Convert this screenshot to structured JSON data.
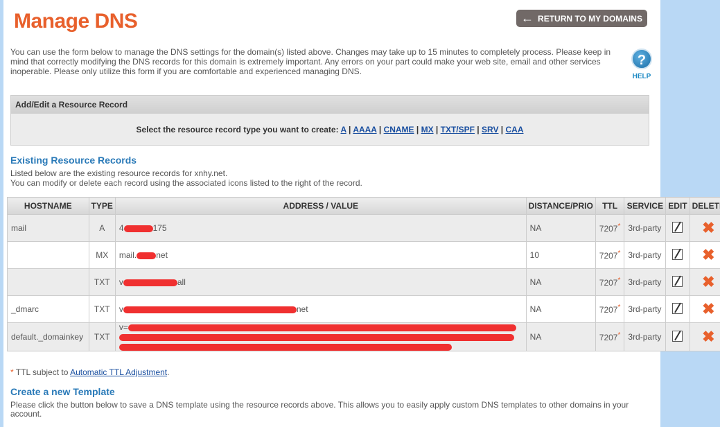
{
  "header": {
    "title": "Manage DNS",
    "return_label": "RETURN TO MY DOMAINS",
    "help_label": "HELP"
  },
  "intro": "You can use the form below to manage the DNS settings for the domain(s) listed above. Changes may take up to 15 minutes to completely process. Please keep in mind that correctly modifying the DNS records for this domain is extremely important. Any errors on your part could make your web site, email and other services inoperable. Please only utilize this form if you are comfortable and experienced managing DNS.",
  "add_record": {
    "title": "Add/Edit a Resource Record",
    "prompt": "Select the resource record type you want to create:",
    "types": [
      "A",
      "AAAA",
      "CNAME",
      "MX",
      "TXT/SPF",
      "SRV",
      "CAA"
    ]
  },
  "existing": {
    "title": "Existing Resource Records",
    "line1": "Listed below are the existing resource records for xnhy.net.",
    "line2": "You can modify or delete each record using the associated icons listed to the right of the record.",
    "columns": [
      "HOSTNAME",
      "TYPE",
      "ADDRESS / VALUE",
      "DISTANCE/PRIO",
      "TTL",
      "SERVICE",
      "EDIT",
      "DELETE"
    ],
    "rows": [
      {
        "host": "mail",
        "type": "A",
        "pre": "4",
        "post": "175",
        "prio": "NA",
        "ttl": "7207",
        "service": "3rd-party"
      },
      {
        "host": "",
        "type": "MX",
        "pre": "mail.",
        "post": "net",
        "prio": "10",
        "ttl": "7207",
        "service": "3rd-party"
      },
      {
        "host": "",
        "type": "TXT",
        "pre": "v",
        "post": "all",
        "prio": "NA",
        "ttl": "7207",
        "service": "3rd-party"
      },
      {
        "host": "_dmarc",
        "type": "TXT",
        "pre": "v",
        "post": "net",
        "prio": "NA",
        "ttl": "7207",
        "service": "3rd-party"
      },
      {
        "host": "default._domainkey",
        "type": "TXT",
        "pre": "v=",
        "post": "",
        "prio": "NA",
        "ttl": "7207",
        "service": "3rd-party"
      }
    ]
  },
  "ttl_note": {
    "prefix": "TTL subject to ",
    "link": "Automatic TTL Adjustment",
    "suffix": "."
  },
  "template": {
    "title": "Create a new Template",
    "text": "Please click the button below to save a DNS template using the resource records above. This allows you to easily apply custom DNS templates to other domains in your account."
  }
}
